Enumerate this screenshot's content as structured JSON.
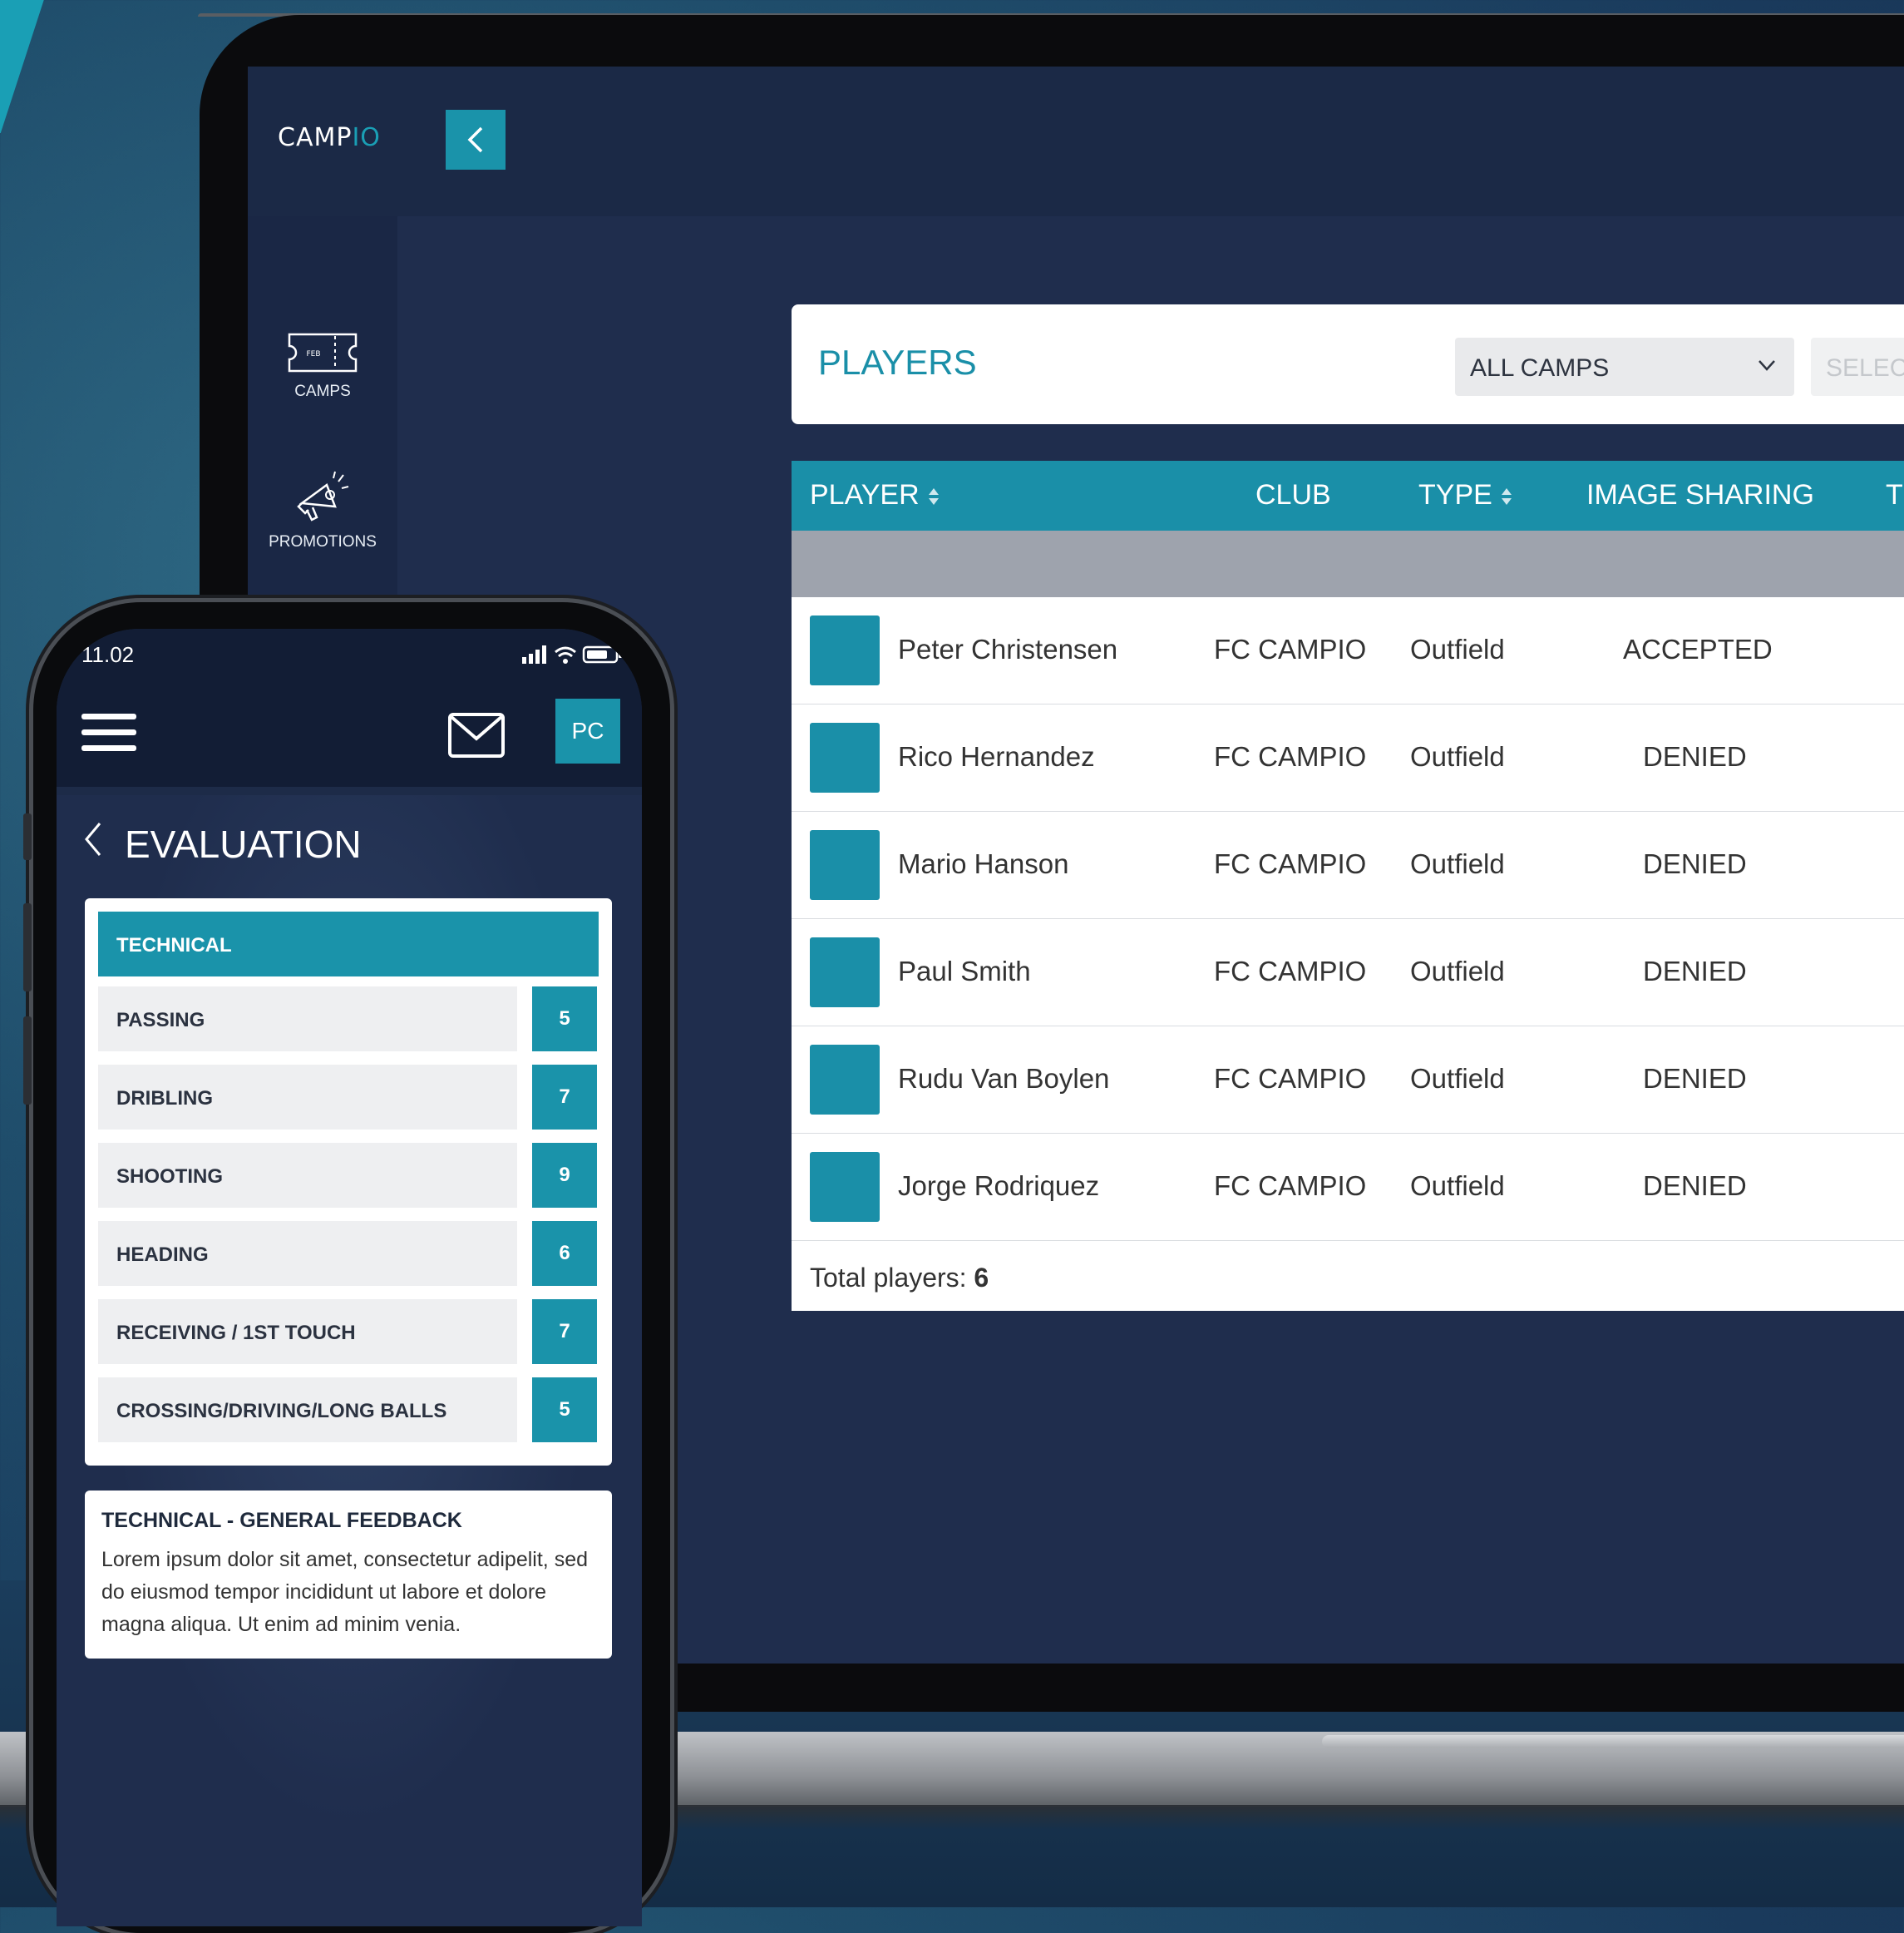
{
  "laptop": {
    "logo_main": "CAMP",
    "logo_accent": "IO",
    "nav": [
      {
        "label": "CAMPS",
        "icon": "ticket-icon"
      },
      {
        "label": "PROMOTIONS",
        "icon": "megaphone-icon"
      },
      {
        "label": "",
        "icon": "football-boot-icon"
      }
    ],
    "players_title": "PLAYERS",
    "camp_select": "ALL CAMPS",
    "second_select": "SELEC",
    "table": {
      "headers": [
        "PLAYER",
        "CLUB",
        "TYPE",
        "IMAGE SHARING",
        "T"
      ],
      "rows": [
        {
          "name": "Peter Christensen",
          "club": "FC CAMPIO",
          "type": "Outfield",
          "sharing": "ACCEPTED"
        },
        {
          "name": "Rico Hernandez",
          "club": "FC CAMPIO",
          "type": "Outfield",
          "sharing": "DENIED"
        },
        {
          "name": "Mario Hanson",
          "club": "FC CAMPIO",
          "type": "Outfield",
          "sharing": "DENIED"
        },
        {
          "name": "Paul Smith",
          "club": "FC CAMPIO",
          "type": "Outfield",
          "sharing": "DENIED"
        },
        {
          "name": "Rudu Van Boylen",
          "club": "FC CAMPIO",
          "type": "Outfield",
          "sharing": "DENIED"
        },
        {
          "name": "Jorge Rodriquez",
          "club": "FC CAMPIO",
          "type": "Outfield",
          "sharing": "DENIED"
        }
      ],
      "total_label": "Total players: ",
      "total_value": "6"
    }
  },
  "phone": {
    "time": "11.02",
    "avatar_initials": "PC",
    "title": "EVALUATION",
    "section": "TECHNICAL",
    "skills": [
      {
        "label": "PASSING",
        "score": "5"
      },
      {
        "label": "DRIBLING",
        "score": "7"
      },
      {
        "label": "SHOOTING",
        "score": "9"
      },
      {
        "label": "HEADING",
        "score": "6"
      },
      {
        "label": "RECEIVING / 1ST TOUCH",
        "score": "7"
      },
      {
        "label": "CROSSING/DRIVING/LONG BALLS",
        "score": "5"
      }
    ],
    "feedback_title": "TECHNICAL - GENERAL FEEDBACK",
    "feedback_text": "Lorem ipsum dolor sit amet, consectetur adipelit, sed do eiusmod tempor incididunt ut labore et dolore magna aliqua. Ut enim ad minim venia."
  },
  "colors": {
    "accent": "#1a93aa",
    "navy": "#1d2b48"
  }
}
